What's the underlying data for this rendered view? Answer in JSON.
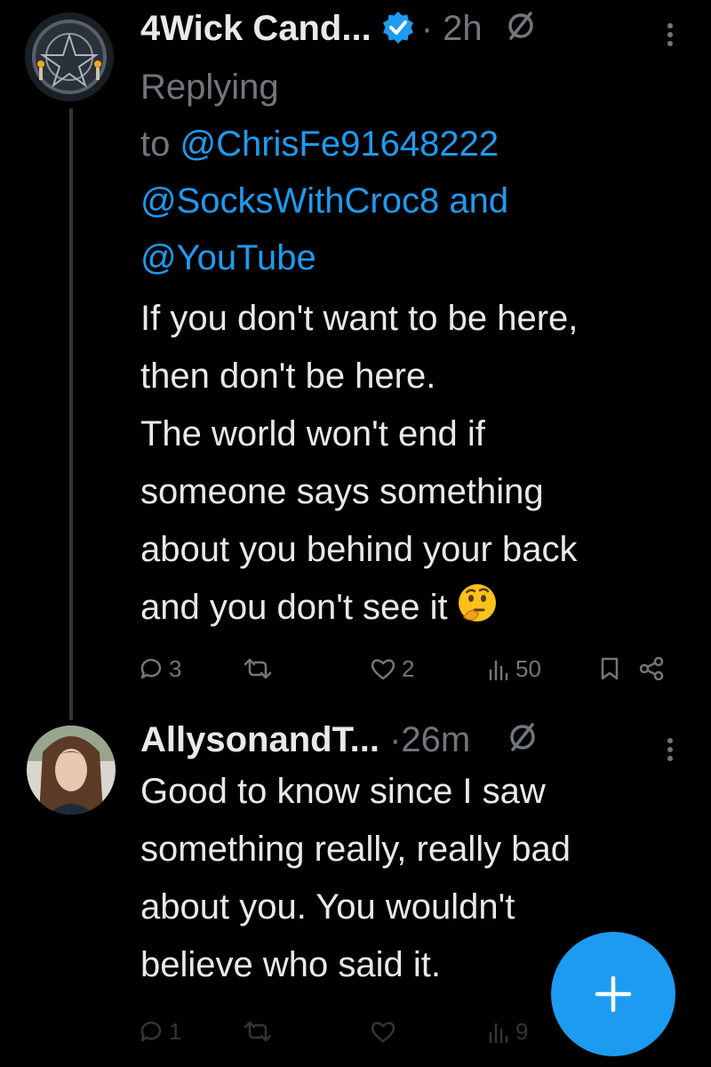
{
  "tweets": [
    {
      "author": "4Wick Cand...",
      "time": "2h",
      "replying_prefix": "Replying",
      "replying_to_word": "to",
      "mentions": [
        "@ChrisFe91648222",
        "@SocksWithCroc8",
        "@YouTube"
      ],
      "mentions_and": "and",
      "text_lines": [
        "If you don't want to be here,",
        "then don't be here.",
        "The world won't end if",
        "someone says something",
        "about you behind your back",
        "and you don't see it"
      ],
      "emoji": "thinking-face",
      "stats": {
        "replies": "3",
        "likes": "2",
        "views": "50"
      }
    },
    {
      "author": "AllysonandT...",
      "time": "26m",
      "text_lines": [
        "Good to know since I saw",
        "something really, really bad",
        "about you. You wouldn't",
        "believe who said it."
      ],
      "stats": {
        "replies": "1",
        "views": "9"
      }
    }
  ],
  "separator": "·",
  "colors": {
    "background": "#000000",
    "text": "#e7e9ea",
    "muted": "#71767b",
    "accent": "#1d9bf0"
  },
  "icons": [
    "verified-badge-icon",
    "grok-slash-icon",
    "more-icon",
    "reply-icon",
    "retweet-icon",
    "like-icon",
    "views-icon",
    "bookmark-icon",
    "share-icon",
    "plus-icon"
  ]
}
